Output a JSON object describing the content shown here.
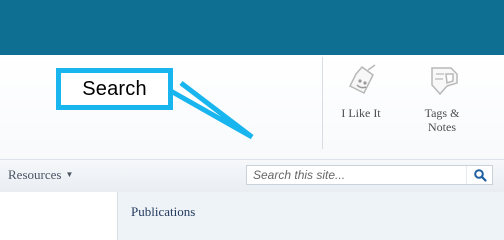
{
  "callout": {
    "label": "Search"
  },
  "ribbon": {
    "like_label": "I Like It",
    "tags_label_line1": "Tags &",
    "tags_label_line2": "Notes"
  },
  "nav": {
    "resources_label": "Resources",
    "search_placeholder": "Search this site..."
  },
  "sidebar": {
    "items": [
      {
        "label": "Publications"
      }
    ]
  },
  "colors": {
    "top_band": "#0f6f93",
    "callout": "#19b5ee",
    "search_icon": "#1f5f9f"
  },
  "icons": {
    "like": "i-like-it-icon",
    "tags": "tags-notes-icon",
    "search": "search-icon"
  }
}
